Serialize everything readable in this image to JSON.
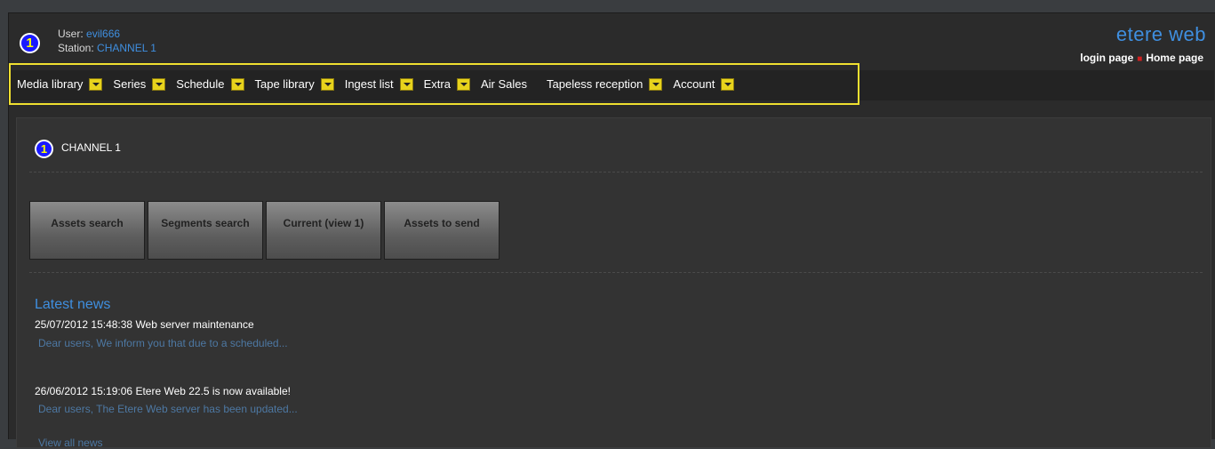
{
  "header": {
    "station_badge": "1",
    "user_label": "User:",
    "user_value": "evil666",
    "station_label": "Station:",
    "station_value": "CHANNEL 1",
    "brand": "etere web",
    "links": [
      "login page",
      "Home page"
    ]
  },
  "menu": {
    "items": [
      {
        "label": "Media library",
        "dropdown": true
      },
      {
        "label": "Series",
        "dropdown": true
      },
      {
        "label": "Schedule",
        "dropdown": true
      },
      {
        "label": "Tape library",
        "dropdown": true
      },
      {
        "label": "Ingest list",
        "dropdown": true
      },
      {
        "label": "Extra",
        "dropdown": true
      },
      {
        "label": "Air Sales",
        "dropdown": false
      },
      {
        "label": "Tapeless reception",
        "dropdown": true
      },
      {
        "label": "Account",
        "dropdown": true
      }
    ],
    "highlight_color": "#f0e030"
  },
  "panel": {
    "badge": "1",
    "channel_title": "CHANNEL 1",
    "buttons": [
      "Assets search",
      "Segments search",
      "Current (view 1)",
      "Assets to send"
    ]
  },
  "news": {
    "title": "Latest news",
    "items": [
      {
        "headline": "25/07/2012 15:48:38 Web server maintenance",
        "snippet": "Dear users, We inform you that due to a scheduled..."
      },
      {
        "headline": "26/06/2012 15:19:06 Etere Web 22.5 is now available!",
        "snippet": "Dear users, The Etere Web server has been updated..."
      }
    ],
    "view_all": "View all news"
  },
  "colors": {
    "accent": "#3f8fe0",
    "badge_fill": "#1a1aff",
    "badge_text": "#ffff00",
    "dropdown": "#e8d31c"
  }
}
